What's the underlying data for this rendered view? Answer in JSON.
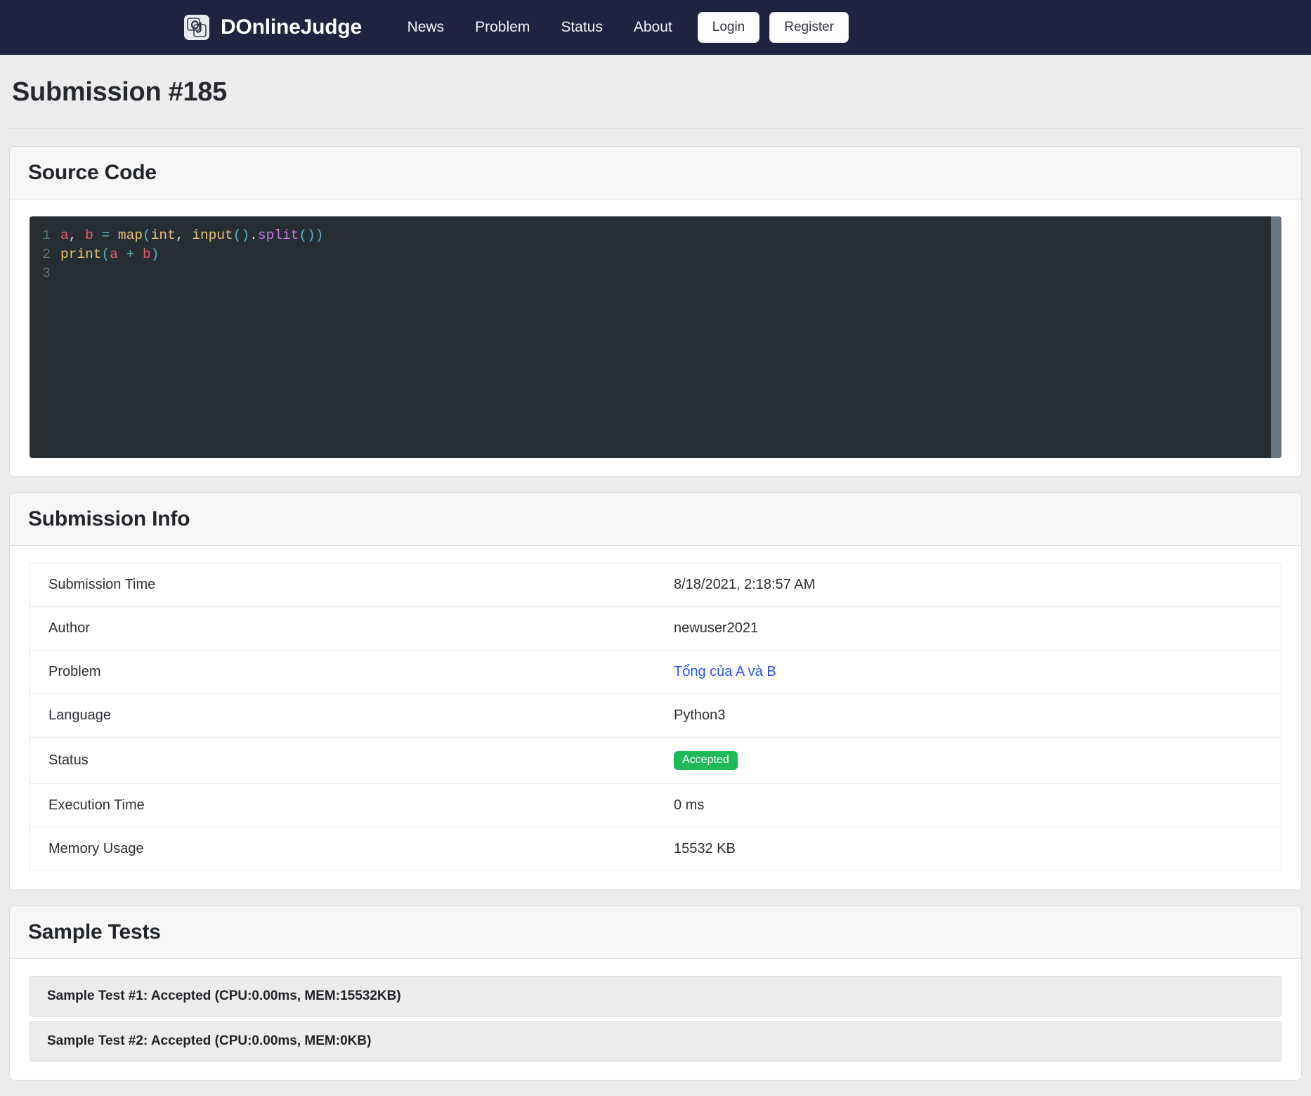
{
  "navbar": {
    "logo_icon": "oj-logo-icon",
    "brand": "DOnlineJudge",
    "links": [
      {
        "label": "News"
      },
      {
        "label": "Problem"
      },
      {
        "label": "Status"
      },
      {
        "label": "About"
      }
    ],
    "login_label": "Login",
    "register_label": "Register"
  },
  "page": {
    "title": "Submission #185"
  },
  "source_code": {
    "heading": "Source Code",
    "lines": [
      {
        "number": "1",
        "tokens": [
          {
            "text": "a",
            "cls": "t-var"
          },
          {
            "text": ", ",
            "cls": "code-txt"
          },
          {
            "text": "b",
            "cls": "t-var"
          },
          {
            "text": " ",
            "cls": "code-txt"
          },
          {
            "text": "=",
            "cls": "t-op"
          },
          {
            "text": " ",
            "cls": "code-txt"
          },
          {
            "text": "map",
            "cls": "t-fn"
          },
          {
            "text": "(",
            "cls": "t-op"
          },
          {
            "text": "int",
            "cls": "t-fn"
          },
          {
            "text": ", ",
            "cls": "code-txt"
          },
          {
            "text": "input",
            "cls": "t-fn"
          },
          {
            "text": "()",
            "cls": "t-op"
          },
          {
            "text": ".",
            "cls": "code-txt"
          },
          {
            "text": "split",
            "cls": "t-meth"
          },
          {
            "text": "())",
            "cls": "t-op"
          }
        ],
        "plain": "a, b = map(int, input().split())"
      },
      {
        "number": "2",
        "tokens": [
          {
            "text": "print",
            "cls": "t-fn"
          },
          {
            "text": "(",
            "cls": "t-op"
          },
          {
            "text": "a",
            "cls": "t-var"
          },
          {
            "text": " ",
            "cls": "code-txt"
          },
          {
            "text": "+",
            "cls": "t-op"
          },
          {
            "text": " ",
            "cls": "code-txt"
          },
          {
            "text": "b",
            "cls": "t-var"
          },
          {
            "text": ")",
            "cls": "t-op"
          }
        ],
        "plain": "print(a + b)"
      },
      {
        "number": "3",
        "tokens": [],
        "plain": ""
      }
    ]
  },
  "submission_info": {
    "heading": "Submission Info",
    "rows": [
      {
        "key": "Submission Time",
        "value": "8/18/2021, 2:18:57 AM",
        "type": "text"
      },
      {
        "key": "Author",
        "value": "newuser2021",
        "type": "text"
      },
      {
        "key": "Problem",
        "value": "Tổng của A và B",
        "type": "link"
      },
      {
        "key": "Language",
        "value": "Python3",
        "type": "text"
      },
      {
        "key": "Status",
        "value": "Accepted",
        "type": "badge"
      },
      {
        "key": "Execution Time",
        "value": "0 ms",
        "type": "text"
      },
      {
        "key": "Memory Usage",
        "value": "15532 KB",
        "type": "text"
      }
    ]
  },
  "sample_tests": {
    "heading": "Sample Tests",
    "items": [
      {
        "label": "Sample Test #1: Accepted (CPU:0.00ms, MEM:15532KB)"
      },
      {
        "label": "Sample Test #2: Accepted (CPU:0.00ms, MEM:0KB)"
      }
    ]
  },
  "colors": {
    "navbar_bg": "#1f2340",
    "accent_link": "#2b55f0",
    "status_accepted": "#1fb958",
    "code_bg": "#272e33",
    "page_bg": "#ececec"
  }
}
